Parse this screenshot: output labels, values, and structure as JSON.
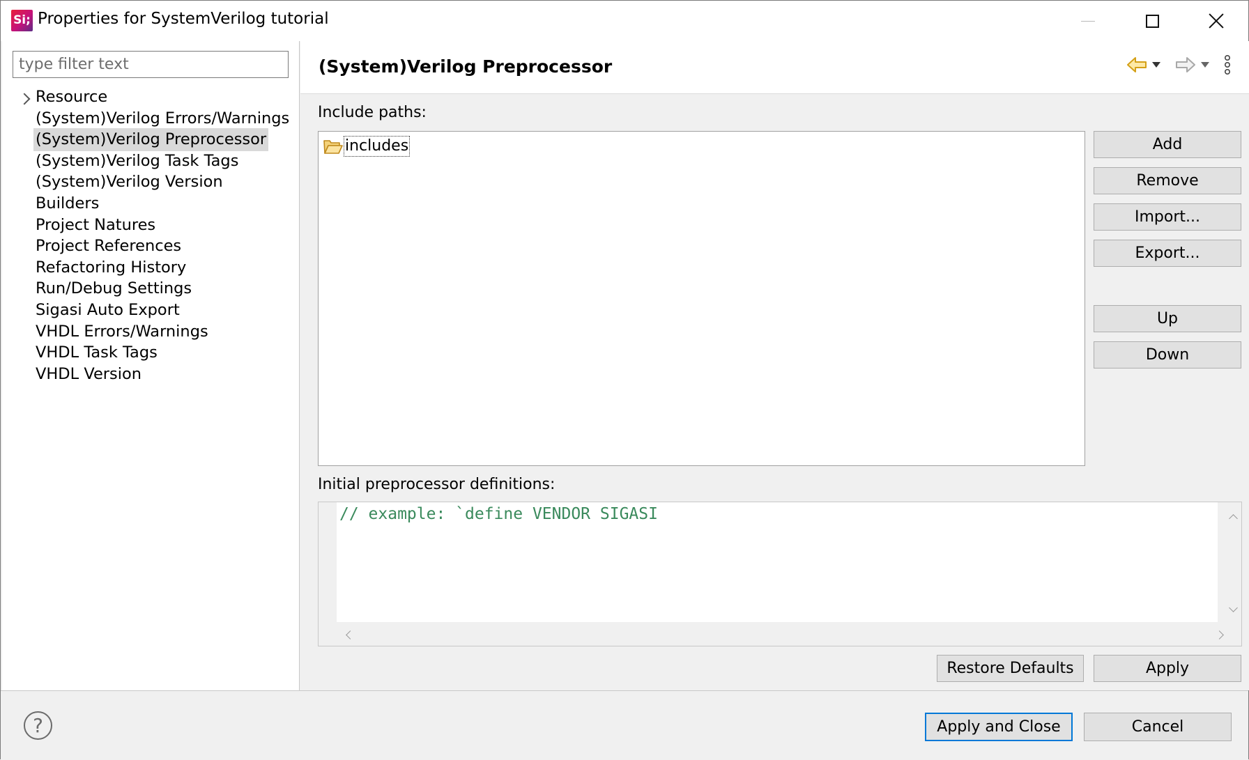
{
  "window": {
    "title": "Properties for SystemVerilog tutorial",
    "app_icon_text": "Si;"
  },
  "sidebar": {
    "filter_placeholder": "type filter text",
    "items": [
      {
        "label": "Resource",
        "expandable": true
      },
      {
        "label": "(System)Verilog Errors/Warnings"
      },
      {
        "label": "(System)Verilog Preprocessor",
        "selected": true
      },
      {
        "label": "(System)Verilog Task Tags"
      },
      {
        "label": "(System)Verilog Version"
      },
      {
        "label": "Builders"
      },
      {
        "label": "Project Natures"
      },
      {
        "label": "Project References"
      },
      {
        "label": "Refactoring History"
      },
      {
        "label": "Run/Debug Settings"
      },
      {
        "label": "Sigasi Auto Export"
      },
      {
        "label": "VHDL Errors/Warnings"
      },
      {
        "label": "VHDL Task Tags"
      },
      {
        "label": "VHDL Version"
      }
    ]
  },
  "page": {
    "title": "(System)Verilog Preprocessor",
    "include_paths_label": "Include paths:",
    "include_paths": [
      "includes"
    ],
    "buttons": {
      "add": "Add",
      "remove": "Remove",
      "import": "Import...",
      "export": "Export...",
      "up": "Up",
      "down": "Down"
    },
    "definitions_label": "Initial preprocessor definitions:",
    "definitions_text": "// example: `define VENDOR SIGASI",
    "restore_defaults": "Restore Defaults",
    "apply": "Apply"
  },
  "footer": {
    "help": "?",
    "apply_and_close": "Apply and Close",
    "cancel": "Cancel"
  },
  "colors": {
    "accent": "#0078d7",
    "back_arrow": "#d4a017",
    "code_comment": "#3a8a5c",
    "selection": "#d9d9d9"
  }
}
